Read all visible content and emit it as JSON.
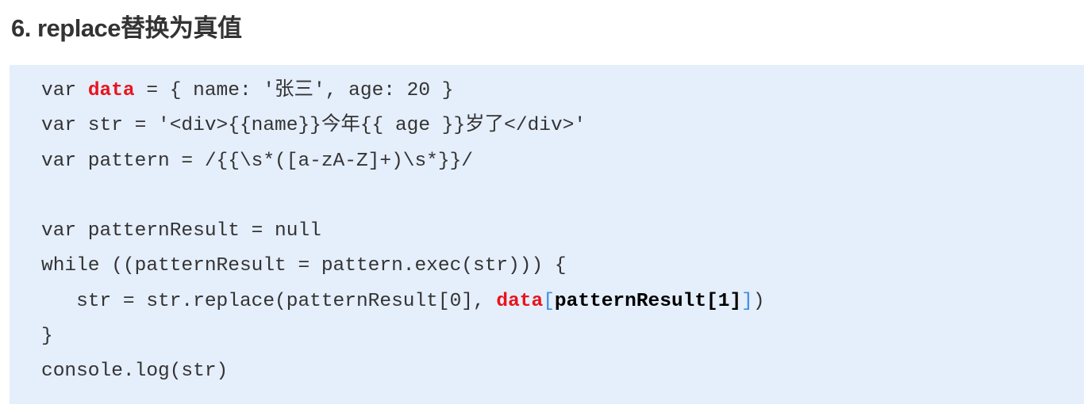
{
  "title": "6. replace替换为真值",
  "code_lines": [
    [
      {
        "t": "var "
      },
      {
        "t": "data",
        "s": "kw-red"
      },
      {
        "t": " = { name: '张三', age: 20 }"
      }
    ],
    [
      {
        "t": "var str = '<div>{{name}}今年{{ age }}岁了</div>'"
      }
    ],
    [
      {
        "t": "var pattern = /{{\\s*([a-zA-Z]+)\\s*}}/"
      }
    ],
    [
      {
        "t": ""
      }
    ],
    [
      {
        "t": "var patternResult = null"
      }
    ],
    [
      {
        "t": "while ((patternResult = pattern.exec(str))) {"
      }
    ],
    [
      {
        "t": "   str = str.replace(patternResult[0], "
      },
      {
        "t": "data",
        "s": "kw-red"
      },
      {
        "t": "[",
        "s": "blue"
      },
      {
        "t": "patternResult[1]",
        "s": "bold"
      },
      {
        "t": "]",
        "s": "blue"
      },
      {
        "t": ")"
      }
    ],
    [
      {
        "t": "}"
      }
    ],
    [
      {
        "t": "console.log(str)"
      }
    ]
  ],
  "colors": {
    "background": "#e5eefb",
    "highlight": "#e8141c",
    "bracket": "#3a8ee6"
  }
}
